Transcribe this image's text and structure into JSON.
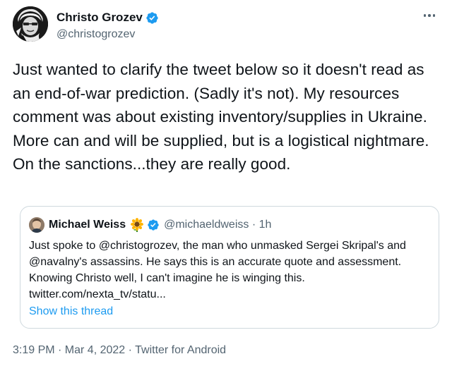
{
  "author": {
    "display_name": "Christo Grozev",
    "handle": "@christogrozev",
    "verified": true,
    "avatar_icon": "grayscale-portrait-avatar"
  },
  "tweet": {
    "text": "Just wanted to clarify the tweet below so it doesn't read as an end-of-war prediction. (Sadly it's not). My resources comment was about existing inventory/supplies in Ukraine. More can and will be supplied, but is a logistical nightmare. On the sanctions...they are really good."
  },
  "quoted_tweet": {
    "display_name": "Michael Weiss",
    "emoji": "🌻",
    "verified": true,
    "handle_time": "@michaeldweiss · 1h",
    "text": "Just spoke to @christogrozev, the man who unmasked Sergei Skripal's and @navalny's assassins. He says this is an accurate quote and assessment. Knowing Christo well, I can't imagine he is winging this. twitter.com/nexta_tv/statu...",
    "show_thread_label": "Show this thread"
  },
  "meta": {
    "timestamp_source": "3:19 PM · Mar 4, 2022 · Twitter for Android"
  },
  "colors": {
    "link": "#1d9bf0",
    "secondary_text": "#536471",
    "primary_text": "#0f1419",
    "border": "#cfd9de"
  }
}
